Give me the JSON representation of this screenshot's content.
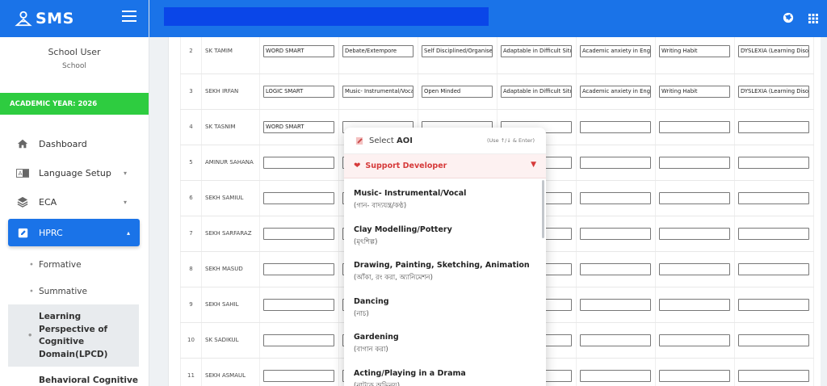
{
  "brand": {
    "name": "SMS"
  },
  "user": {
    "name": "School User",
    "role": "School"
  },
  "academic_year": "ACADEMIC YEAR: 2026",
  "nav": {
    "dashboard": "Dashboard",
    "language": "Language Setup",
    "eca": "ECA",
    "hprc": "HPRC",
    "sub": {
      "formative": "Formative",
      "summative": "Summative",
      "lpcd": "Learning Perspective of Cognitive Domain(LPCD)",
      "behavioral": "Behavioral Cognitive"
    }
  },
  "rows": [
    {
      "num": "2",
      "name": "SK TAMIM",
      "cells": [
        "WORD SMART",
        "Debate/Extempore",
        "Self Disciplined/Organised",
        "Adaptable in Difficult Situ",
        "Academic anxiety in Engli",
        "Writing Habit",
        "DYSLEXIA (Learning Diso"
      ]
    },
    {
      "num": "3",
      "name": "SEKH IRFAN",
      "cells": [
        "LOGIC SMART",
        "Music- Instrumental/Voca",
        "Open Minded",
        "Adaptable in Difficult Situ",
        "Academic anxiety in Engli",
        "Writing Habit",
        "DYSLEXIA (Learning Diso"
      ]
    },
    {
      "num": "4",
      "name": "SK TASNIM",
      "cells": [
        "WORD SMART",
        "",
        "",
        "",
        "",
        "",
        ""
      ]
    },
    {
      "num": "5",
      "name": "AMINUR SAHANA",
      "cells": [
        "",
        "",
        "",
        "",
        "",
        "",
        ""
      ]
    },
    {
      "num": "6",
      "name": "SEKH SAMIUL",
      "cells": [
        "",
        "",
        "",
        "",
        "",
        "",
        ""
      ]
    },
    {
      "num": "7",
      "name": "SEKH SARFARAZ",
      "cells": [
        "",
        "",
        "",
        "",
        "",
        "",
        ""
      ]
    },
    {
      "num": "8",
      "name": "SEKH MASUD",
      "cells": [
        "",
        "",
        "",
        "",
        "",
        "",
        ""
      ]
    },
    {
      "num": "9",
      "name": "SEKH SAHIL",
      "cells": [
        "",
        "",
        "",
        "",
        "",
        "",
        ""
      ]
    },
    {
      "num": "10",
      "name": "SK SADIKUL",
      "cells": [
        "",
        "",
        "",
        "",
        "",
        "",
        ""
      ]
    },
    {
      "num": "11",
      "name": "SEKH ASMAUL",
      "cells": [
        "",
        "",
        "",
        "",
        "",
        "",
        ""
      ]
    }
  ],
  "dropdown": {
    "title_prefix": "Select",
    "title_bold": "AOI",
    "hint": "(Use ↑/↓ & Enter)",
    "support": "Support Developer",
    "options": [
      {
        "en": "Music- Instrumental/Vocal",
        "bn": "(গান- বাদ্যযন্ত্র/কণ্ঠ)"
      },
      {
        "en": "Clay Modelling/Pottery",
        "bn": "(মৃৎশিল্প)"
      },
      {
        "en": "Drawing, Painting, Sketching, Animation",
        "bn": "(আঁকা, রং করা, অ্যানিমেশন)"
      },
      {
        "en": "Dancing",
        "bn": "(নাচ)"
      },
      {
        "en": "Gardening",
        "bn": "(বাগান করা)"
      },
      {
        "en": "Acting/Playing in a Drama",
        "bn": "(নাটকে অভিনয়)"
      }
    ]
  },
  "colors": {
    "primary": "#1a73e8",
    "academic": "#2ecc40",
    "support": "#d63a3a"
  }
}
